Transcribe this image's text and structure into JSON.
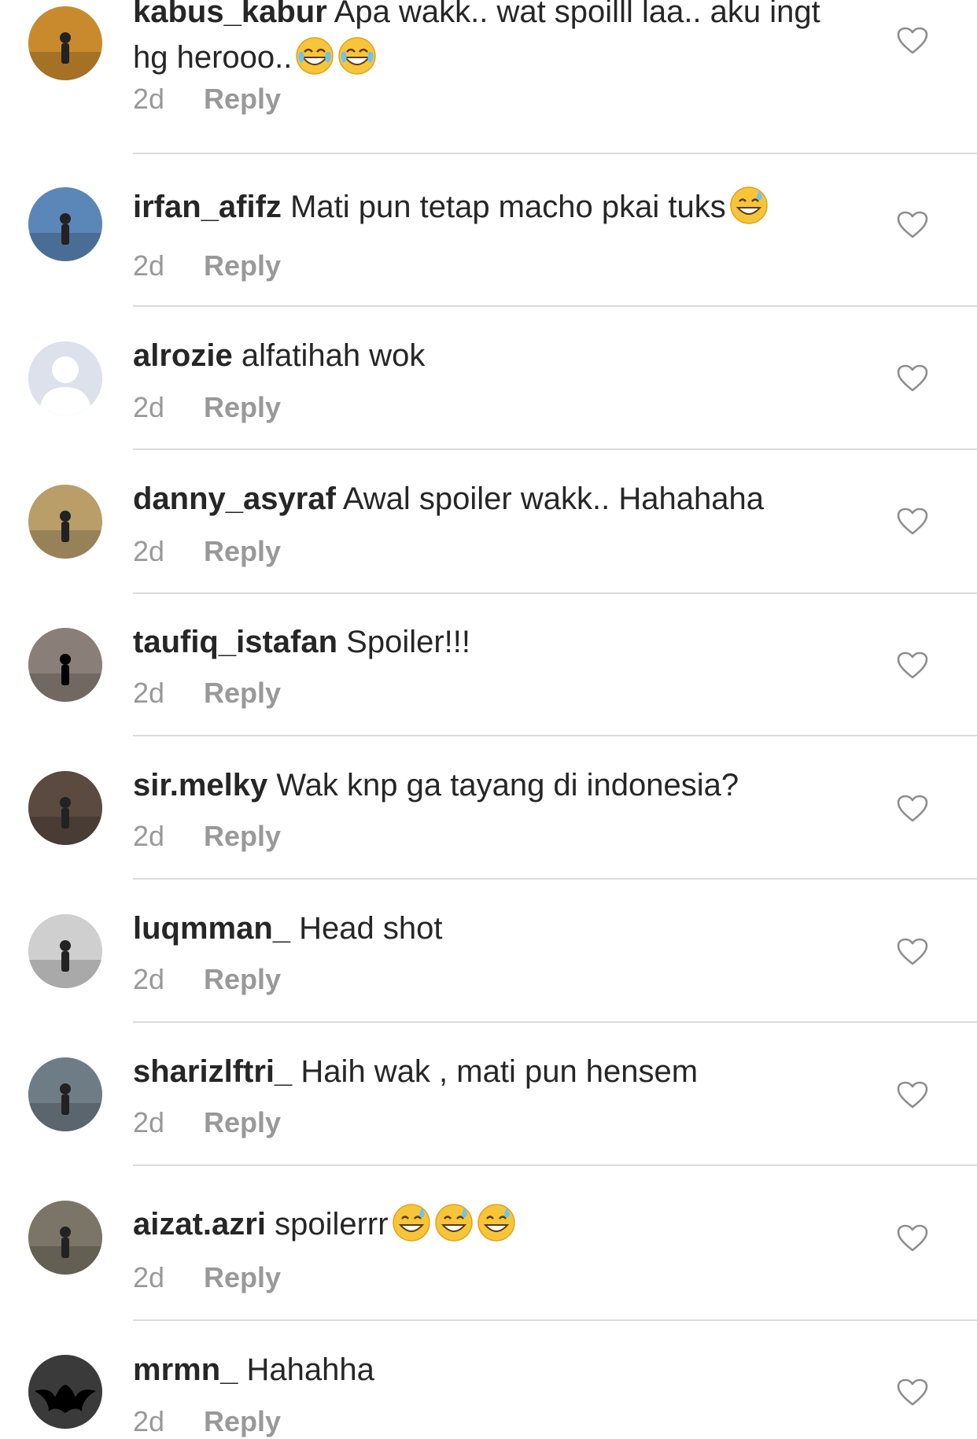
{
  "comments": [
    {
      "username": "kabus_kabur",
      "text": "Apa wakk.. wat spoilll laa.. aku ingt hg herooo..",
      "emoji_names": [
        "tears-of-joy-emoji",
        "tears-of-joy-emoji"
      ],
      "time": "2d",
      "reply": "Reply",
      "avatar_color": "#c98a2e"
    },
    {
      "username": "irfan_afifz",
      "text": "Mati pun tetap macho pkai tuks",
      "emoji_names": [
        "grinning-sweat-emoji"
      ],
      "time": "2d",
      "reply": "Reply",
      "avatar_color": "#5b86b8"
    },
    {
      "username": "alrozie",
      "text": "alfatihah wok",
      "emoji_names": [],
      "time": "2d",
      "reply": "Reply",
      "avatar_color": "#dfe3ee"
    },
    {
      "username": "danny_asyraf",
      "text": "Awal spoiler wakk.. Hahahaha",
      "emoji_names": [],
      "time": "2d",
      "reply": "Reply",
      "avatar_color": "#b99e6a"
    },
    {
      "username": "taufiq_istafan",
      "text": "Spoiler!!!",
      "emoji_names": [],
      "time": "2d",
      "reply": "Reply",
      "avatar_color": "#8a7f78"
    },
    {
      "username": "sir.melky",
      "text": "Wak knp ga tayang di indonesia?",
      "emoji_names": [],
      "time": "2d",
      "reply": "Reply",
      "avatar_color": "#5a4a40"
    },
    {
      "username": "luqmman_",
      "text": "Head shot",
      "emoji_names": [],
      "time": "2d",
      "reply": "Reply",
      "avatar_color": "#cfcfcf"
    },
    {
      "username": "sharizlftri_",
      "text": "Haih wak , mati pun hensem",
      "emoji_names": [],
      "time": "2d",
      "reply": "Reply",
      "avatar_color": "#6e7c86"
    },
    {
      "username": "aizat.azri",
      "text": "spoilerrr",
      "emoji_names": [
        "grinning-sweat-emoji",
        "grinning-sweat-emoji",
        "grinning-sweat-emoji"
      ],
      "time": "2d",
      "reply": "Reply",
      "avatar_color": "#7a7566"
    },
    {
      "username": "mrmn_",
      "text": "Hahahha",
      "emoji_names": [],
      "time": "2d",
      "reply": "Reply",
      "avatar_color": "#2a2a2a"
    }
  ],
  "icons": {
    "like": "heart-outline-icon"
  },
  "colors": {
    "text": "#262626",
    "meta": "#999999",
    "divider": "#dbdbdb",
    "heart": "#8e8e8e"
  }
}
